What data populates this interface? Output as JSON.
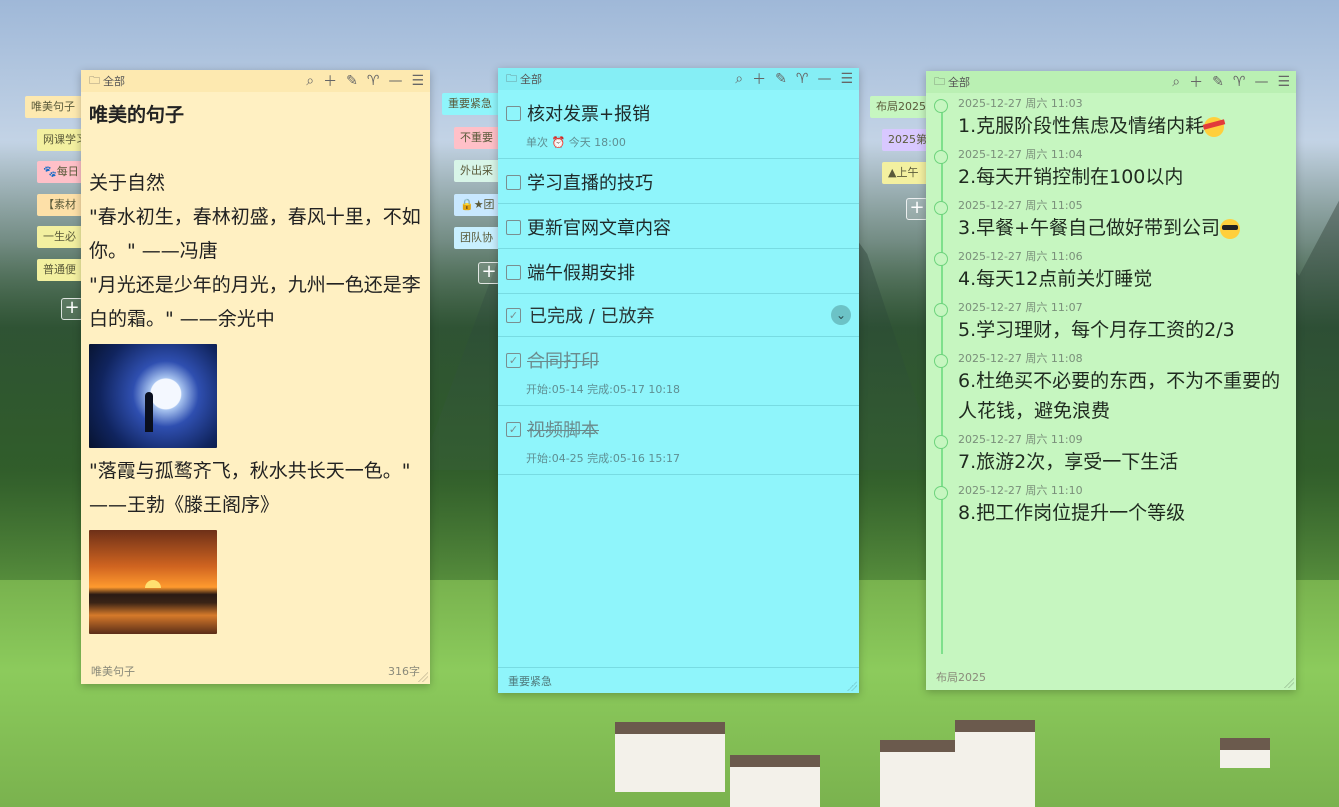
{
  "note_yellow": {
    "folder": "全部",
    "title": "唯美的句子",
    "lines": [
      "关于自然",
      "\"春水初生，春林初盛，春风十里，不如你。\" ——冯唐",
      "\"月光还是少年的月光，九州一色还是李白的霜。\" ——余光中",
      "\"落霞与孤鹜齐飞，秋水共长天一色。\" ——王勃《滕王阁序》"
    ],
    "footer_tag": "唯美句子",
    "char_count": "316字",
    "side_tags": [
      {
        "label": "唯美句子",
        "color": "#fde9b0"
      },
      {
        "label": "网课学习",
        "color": "#f3f0a0"
      },
      {
        "label": "🐾每日",
        "color": "#ffc0c8"
      },
      {
        "label": "【素材",
        "color": "#fde0a8"
      },
      {
        "label": "一生必",
        "color": "#f3f0a0"
      },
      {
        "label": "普通便",
        "color": "#f3f0a0"
      }
    ]
  },
  "note_cyan": {
    "folder": "全部",
    "todos": [
      {
        "text": "核对发票+报销",
        "meta": "单次  ⏰  今天 18:00"
      },
      {
        "text": "学习直播的技巧"
      },
      {
        "text": "更新官网文章内容"
      },
      {
        "text": "端午假期安排"
      }
    ],
    "section_label": "已完成 / 已放弃",
    "done": [
      {
        "text": "合同打印",
        "meta": "开始:05-14  完成:05-17 10:18"
      },
      {
        "text": "视频脚本",
        "meta": "开始:04-25  完成:05-16 15:17"
      }
    ],
    "footer_tag": "重要紧急",
    "side_tags": [
      {
        "label": "重要紧急",
        "color": "#8ff5fb"
      },
      {
        "label": "不重要",
        "color": "#ffc0c8"
      },
      {
        "label": "外出采",
        "color": "#d8f5e8"
      },
      {
        "label": "🔒★团",
        "color": "#c8e8ff"
      },
      {
        "label": "团队协",
        "color": "#c8f0ff"
      }
    ]
  },
  "note_green": {
    "folder": "全部",
    "entries": [
      {
        "time": "2025-12-27 周六 11:03",
        "text": "1.克服阶段性焦虑及情绪内耗",
        "emoji": "tape"
      },
      {
        "time": "2025-12-27 周六 11:04",
        "text": "2.每天开销控制在100以内"
      },
      {
        "time": "2025-12-27 周六 11:05",
        "text": "3.早餐+午餐自己做好带到公司",
        "emoji": "shades"
      },
      {
        "time": "2025-12-27 周六 11:06",
        "text": "4.每天12点前关灯睡觉"
      },
      {
        "time": "2025-12-27 周六 11:07",
        "text": "5.学习理财，每个月存工资的2/3"
      },
      {
        "time": "2025-12-27 周六 11:08",
        "text": "6.杜绝买不必要的东西，不为不重要的人花钱，避免浪费"
      },
      {
        "time": "2025-12-27 周六 11:09",
        "text": "7.旅游2次，享受一下生活"
      },
      {
        "time": "2025-12-27 周六 11:10",
        "text": "8.把工作岗位提升一个等级"
      }
    ],
    "footer_tag": "布局2025",
    "side_tags": [
      {
        "label": "布局2025",
        "color": "#c6f6c0"
      },
      {
        "label": "2025第",
        "color": "#d8c8ff"
      },
      {
        "label": "▲上午",
        "color": "#f3f0a0"
      }
    ]
  },
  "header_icons": [
    "folder-icon",
    "search-icon",
    "plus-icon",
    "pin-icon",
    "shirt-icon",
    "minimize-icon",
    "menu-icon"
  ]
}
